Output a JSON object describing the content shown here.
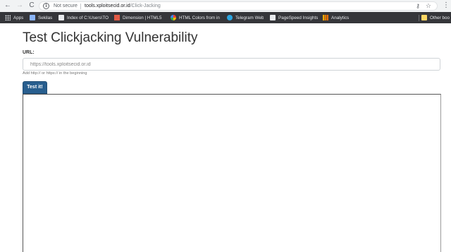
{
  "browser": {
    "nav": {
      "back": "←",
      "forward": "→",
      "reload": "C"
    },
    "security_label": "Not secure",
    "url_host": "tools.xploitsecid.or.id",
    "url_path": "/Click-Jacking",
    "menu": "⋮"
  },
  "bookmarks": {
    "items": [
      {
        "label": "Apps",
        "icon": "apps-grid-icon"
      },
      {
        "label": "Sekilas",
        "icon": "sekilas-icon"
      },
      {
        "label": "Index of C:\\Users\\TO",
        "icon": "file-icon"
      },
      {
        "label": "Dimension | HTML5",
        "icon": "dimension-icon"
      },
      {
        "label": "HTML Colors from in",
        "icon": "html-colors-icon"
      },
      {
        "label": "Telegram Web",
        "icon": "telegram-icon"
      },
      {
        "label": "PageSpeed Insights",
        "icon": "pagespeed-icon"
      },
      {
        "label": "Analytics",
        "icon": "analytics-icon"
      },
      {
        "label": "Other boo",
        "icon": "folder-icon"
      }
    ]
  },
  "page": {
    "title": "Test Clickjacking Vulnerability",
    "url_label": "URL:",
    "url_input_placeholder": "https://tools.xploitsecid.or.id",
    "help_text": "Add http:// or https:// in the beginning",
    "test_button": "Test it!"
  }
}
